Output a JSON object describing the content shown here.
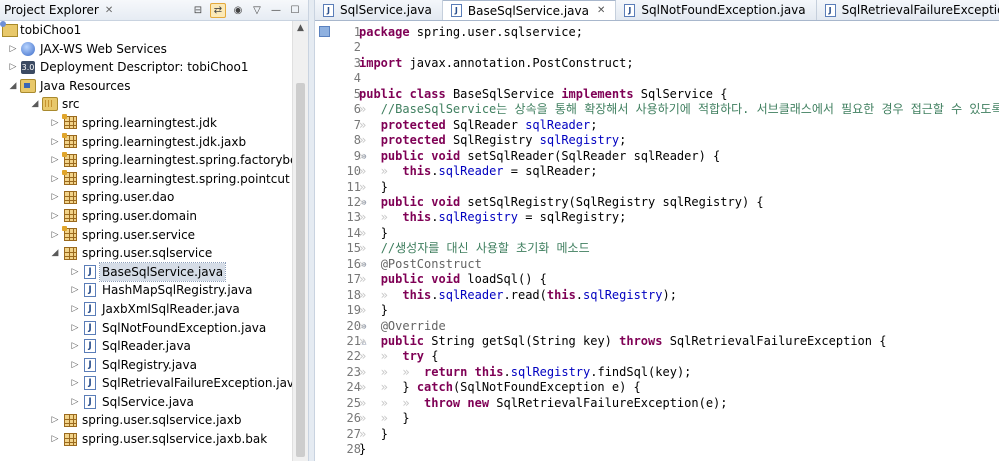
{
  "explorer": {
    "title": "Project Explorer",
    "tree": [
      {
        "label": "tobiChoo1",
        "icon": "project-icon",
        "arrow": "",
        "indent": 0
      },
      {
        "label": "JAX-WS Web Services",
        "icon": "web-services-icon",
        "arrow": "▷",
        "indent": 1
      },
      {
        "label": "Deployment Descriptor: tobiChoo1",
        "icon": "deployment-descriptor-icon",
        "arrow": "▷",
        "indent": 1
      },
      {
        "label": "Java Resources",
        "icon": "java-resources-icon",
        "arrow": "◢",
        "indent": 1
      },
      {
        "label": "src",
        "icon": "source-folder-icon",
        "arrow": "◢",
        "indent": 2
      },
      {
        "label": "spring.learningtest.jdk",
        "icon": "package-icon",
        "arrow": "▷",
        "indent": 3
      },
      {
        "label": "spring.learningtest.jdk.jaxb",
        "icon": "package-icon",
        "arrow": "▷",
        "indent": 3
      },
      {
        "label": "spring.learningtest.spring.factorybean",
        "icon": "package-icon",
        "arrow": "▷",
        "indent": 3
      },
      {
        "label": "spring.learningtest.spring.pointcut",
        "icon": "package-icon",
        "arrow": "▷",
        "indent": 3
      },
      {
        "label": "spring.user.dao",
        "icon": "package-icon",
        "arrow": "▷",
        "indent": 3
      },
      {
        "label": "spring.user.domain",
        "icon": "package-icon",
        "arrow": "▷",
        "indent": 3
      },
      {
        "label": "spring.user.service",
        "icon": "package-icon",
        "arrow": "▷",
        "indent": 3
      },
      {
        "label": "spring.user.sqlservice",
        "icon": "package-icon",
        "arrow": "◢",
        "indent": 3
      },
      {
        "label": "BaseSqlService.java",
        "icon": "java-file-icon",
        "arrow": "▷",
        "indent": 4,
        "selected": true
      },
      {
        "label": "HashMapSqlRegistry.java",
        "icon": "java-file-icon",
        "arrow": "▷",
        "indent": 4
      },
      {
        "label": "JaxbXmlSqlReader.java",
        "icon": "java-file-icon",
        "arrow": "▷",
        "indent": 4
      },
      {
        "label": "SqlNotFoundException.java",
        "icon": "java-file-icon",
        "arrow": "▷",
        "indent": 4
      },
      {
        "label": "SqlReader.java",
        "icon": "java-file-icon",
        "arrow": "▷",
        "indent": 4
      },
      {
        "label": "SqlRegistry.java",
        "icon": "java-file-icon",
        "arrow": "▷",
        "indent": 4
      },
      {
        "label": "SqlRetrievalFailureException.java",
        "icon": "java-file-icon",
        "arrow": "▷",
        "indent": 4
      },
      {
        "label": "SqlService.java",
        "icon": "java-file-icon",
        "arrow": "▷",
        "indent": 4
      },
      {
        "label": "spring.user.sqlservice.jaxb",
        "icon": "package-icon",
        "arrow": "▷",
        "indent": 3
      },
      {
        "label": "spring.user.sqlservice.jaxb.bak",
        "icon": "package-icon",
        "arrow": "▷",
        "indent": 3
      }
    ]
  },
  "editor": {
    "tabs": [
      {
        "label": "SqlService.java",
        "active": false
      },
      {
        "label": "BaseSqlService.java",
        "active": true
      },
      {
        "label": "SqlNotFoundException.java",
        "active": false
      },
      {
        "label": "SqlRetrievalFailureException.java",
        "active": false
      }
    ],
    "lines": [
      {
        "n": "1",
        "fold": "",
        "html": "<span class='kw'>package</span> spring.user.sqlservice;"
      },
      {
        "n": "2",
        "fold": "",
        "html": ""
      },
      {
        "n": "3",
        "fold": "",
        "html": "<span class='kw'>import</span> javax.annotation.PostConstruct;"
      },
      {
        "n": "4",
        "fold": "",
        "html": ""
      },
      {
        "n": "5",
        "fold": "",
        "html": "<span class='kw'>public</span> <span class='kw'>class</span> BaseSqlService <span class='kw'>implements</span> SqlService {"
      },
      {
        "n": "6",
        "fold": "",
        "html": "<span class='ws'>»  </span><span class='cm'>//BaseSqlService는 상속을 통해 확장해서 사용하기에 적합하다. 서브클래스에서 필요한 경우 접근할 수 있도록 protected 선언</span>"
      },
      {
        "n": "7",
        "fold": "",
        "html": "<span class='ws'>»  </span><span class='kw'>protected</span> SqlReader <span class='fld'>sqlReader</span>;"
      },
      {
        "n": "8",
        "fold": "",
        "html": "<span class='ws'>»  </span><span class='kw'>protected</span> SqlRegistry <span class='fld'>sqlRegistry</span>;"
      },
      {
        "n": "9",
        "fold": "⊖",
        "html": "<span class='ws'>»  </span><span class='kw'>public</span> <span class='kw'>void</span> setSqlReader(SqlReader sqlReader) {"
      },
      {
        "n": "10",
        "fold": "",
        "html": "<span class='ws'>»  »  </span><span class='kw'>this</span>.<span class='fld'>sqlReader</span> = sqlReader;"
      },
      {
        "n": "11",
        "fold": "",
        "html": "<span class='ws'>»  </span>}"
      },
      {
        "n": "12",
        "fold": "⊖",
        "html": "<span class='ws'>»  </span><span class='kw'>public</span> <span class='kw'>void</span> setSqlRegistry(SqlRegistry sqlRegistry) {"
      },
      {
        "n": "13",
        "fold": "",
        "html": "<span class='ws'>»  »  </span><span class='kw'>this</span>.<span class='fld'>sqlRegistry</span> = sqlRegistry;"
      },
      {
        "n": "14",
        "fold": "",
        "html": "<span class='ws'>»  </span>}"
      },
      {
        "n": "15",
        "fold": "",
        "html": "<span class='ws'>»  </span><span class='cm'>//생성자를 대신 사용할 초기화 메소드</span>"
      },
      {
        "n": "16",
        "fold": "⊖",
        "html": "<span class='ws'>»  </span><span class='an'>@PostConstruct</span>"
      },
      {
        "n": "17",
        "fold": "",
        "html": "<span class='ws'>»  </span><span class='kw'>public</span> <span class='kw'>void</span> loadSql() {"
      },
      {
        "n": "18",
        "fold": "",
        "html": "<span class='ws'>»  »  </span><span class='kw'>this</span>.<span class='fld'>sqlReader</span>.read(<span class='kw'>this</span>.<span class='fld'>sqlRegistry</span>);"
      },
      {
        "n": "19",
        "fold": "",
        "html": "<span class='ws'>»  </span>}"
      },
      {
        "n": "20",
        "fold": "⊖",
        "html": "<span class='ws'>»  </span><span class='an'>@Override</span>"
      },
      {
        "n": "21",
        "fold": "△",
        "html": "<span class='ws'>»  </span><span class='kw'>public</span> String getSql(String key) <span class='kw'>throws</span> SqlRetrievalFailureException {"
      },
      {
        "n": "22",
        "fold": "",
        "html": "<span class='ws'>»  »  </span><span class='kw'>try</span> {"
      },
      {
        "n": "23",
        "fold": "",
        "html": "<span class='ws'>»  »  »  </span><span class='kw'>return</span> <span class='kw'>this</span>.<span class='fld'>sqlRegistry</span>.findSql(key);"
      },
      {
        "n": "24",
        "fold": "",
        "html": "<span class='ws'>»  »  </span>} <span class='kw'>catch</span>(SqlNotFoundException e) {"
      },
      {
        "n": "25",
        "fold": "",
        "html": "<span class='ws'>»  »  »  </span><span class='kw'>throw</span> <span class='kw'>new</span> SqlRetrievalFailureException(e);"
      },
      {
        "n": "26",
        "fold": "",
        "html": "<span class='ws'>»  »  </span>}"
      },
      {
        "n": "27",
        "fold": "",
        "html": "<span class='ws'>»  </span>}"
      },
      {
        "n": "28",
        "fold": "",
        "html": "}"
      }
    ]
  }
}
